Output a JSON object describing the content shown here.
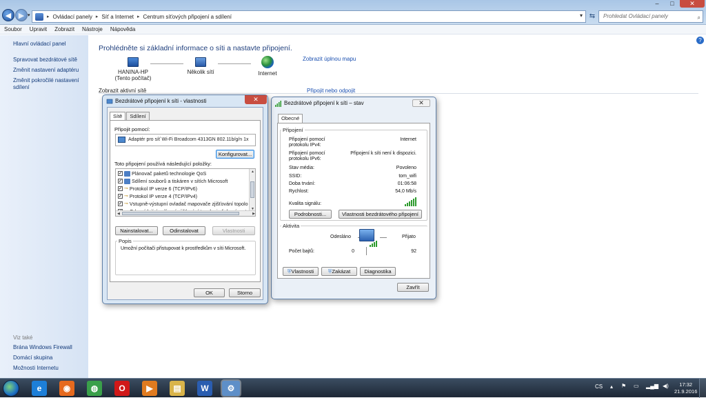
{
  "window": {
    "address": [
      "Ovládací panely",
      "Síť a Internet",
      "Centrum síťových připojení a sdílení"
    ],
    "search_placeholder": "Prohledat Ovládací panely",
    "controls": {
      "minimize": "–",
      "maximize": "□",
      "close": "✕"
    }
  },
  "menu": [
    "Soubor",
    "Upravit",
    "Zobrazit",
    "Nástroje",
    "Nápověda"
  ],
  "sidebar": {
    "items": [
      "Hlavní ovládací panel",
      "Spravovat bezdrátové sítě",
      "Změnit nastavení adaptéru",
      "Změnit pokročilé nastavení sdílení"
    ],
    "see_also_title": "Viz také",
    "see_also": [
      "Brána Windows Firewall",
      "Domácí skupina",
      "Možnosti Internetu"
    ]
  },
  "main": {
    "title": "Prohlédněte si základní informace o síti a nastavte připojení.",
    "full_map_link": "Zobrazit úplnou mapu",
    "nodes": [
      {
        "name": "HANINA-HP",
        "sub": "(Tento počítač)"
      },
      {
        "name": "Několik sítí",
        "sub": ""
      },
      {
        "name": "Internet",
        "sub": ""
      }
    ],
    "active_networks_label": "Zobrazit aktivní sítě",
    "connect_link": "Připojit nebo odpojit"
  },
  "properties_dialog": {
    "title": "Bezdrátové připojení k síti - vlastnosti",
    "close": "✕",
    "tabs": [
      "Sítě",
      "Sdílení"
    ],
    "connect_using_label": "Připojit pomocí:",
    "adapter": "Adaptér pro síť Wi-Fi Broadcom 4313GN 802.11b/g/n 1x",
    "configure_button": "Konfigurovat...",
    "items_label": "Toto připojení používá následující položky:",
    "items": [
      {
        "label": "Plánovač paketů technologie QoS",
        "checked": true
      },
      {
        "label": "Sdílení souborů a tiskáren v sítích Microsoft",
        "checked": true
      },
      {
        "label": "Protokol IP verze 6 (TCP/IPv6)",
        "checked": true
      },
      {
        "label": "Protokol IP verze 4 (TCP/IPv4)",
        "checked": true
      },
      {
        "label": "Vstupně-výstupní ovladač mapovače zjišťování topolo",
        "checked": true
      },
      {
        "label": "Odpovídající zařízení zjišťování topologie linkové vrst",
        "checked": true
      }
    ],
    "install_button": "Nainstalovat...",
    "uninstall_button": "Odinstalovat",
    "properties_button": "Vlastnosti",
    "description_label": "Popis",
    "description": "Umožní počítači přistupovat k prostředkům v síti Microsoft.",
    "ok_button": "OK",
    "cancel_button": "Storno"
  },
  "status_dialog": {
    "title": "Bezdrátové připojení k síti – stav",
    "close": "✕",
    "tab": "Obecné",
    "connection_group": "Připojení",
    "ipv4_label_1": "Připojení pomocí",
    "ipv4_label_2": "protokolu IPv4:",
    "ipv4_value": "Internet",
    "ipv6_label_1": "Připojení pomocí",
    "ipv6_label_2": "protokolu IPv6:",
    "ipv6_value": "Připojení k síti není k dispozici.",
    "media_state_label": "Stav média:",
    "media_state_value": "Povoleno",
    "ssid_label": "SSID:",
    "ssid_value": "tom_wifi",
    "duration_label": "Doba trvání:",
    "duration_value": "01:06:58",
    "speed_label": "Rychlost:",
    "speed_value": "54,0 Mb/s",
    "signal_label": "Kvalita signálu:",
    "signal_bars": 5,
    "details_button": "Podrobnosti...",
    "wireless_props_button": "Vlastnosti bezdrátového připojení",
    "activity_group": "Aktivita",
    "sent_label": "Odesláno",
    "received_label": "Přijato",
    "bytes_label": "Počet bajtů:",
    "bytes_sent": "0",
    "bytes_received": "92",
    "properties_button": "Vlastnosti",
    "disable_button": "Zakázat",
    "diagnose_button": "Diagnostika",
    "close_button": "Zavřít"
  },
  "taskbar": {
    "apps": [
      {
        "name": "internet-explorer",
        "glyph": "e",
        "color": "#1d7fd8"
      },
      {
        "name": "firefox",
        "glyph": "◉",
        "color": "#e66a1f"
      },
      {
        "name": "chrome",
        "glyph": "◍",
        "color": "#3aa04a"
      },
      {
        "name": "opera",
        "glyph": "O",
        "color": "#d01818"
      },
      {
        "name": "media-player",
        "glyph": "▶",
        "color": "#e07b20"
      },
      {
        "name": "explorer",
        "glyph": "▤",
        "color": "#d9b44a"
      },
      {
        "name": "word",
        "glyph": "W",
        "color": "#2a5db0"
      },
      {
        "name": "control-panel",
        "glyph": "⚙",
        "color": "#5e8fc8"
      }
    ],
    "language": "CS",
    "time": "17:32",
    "date": "21.9.2016"
  }
}
